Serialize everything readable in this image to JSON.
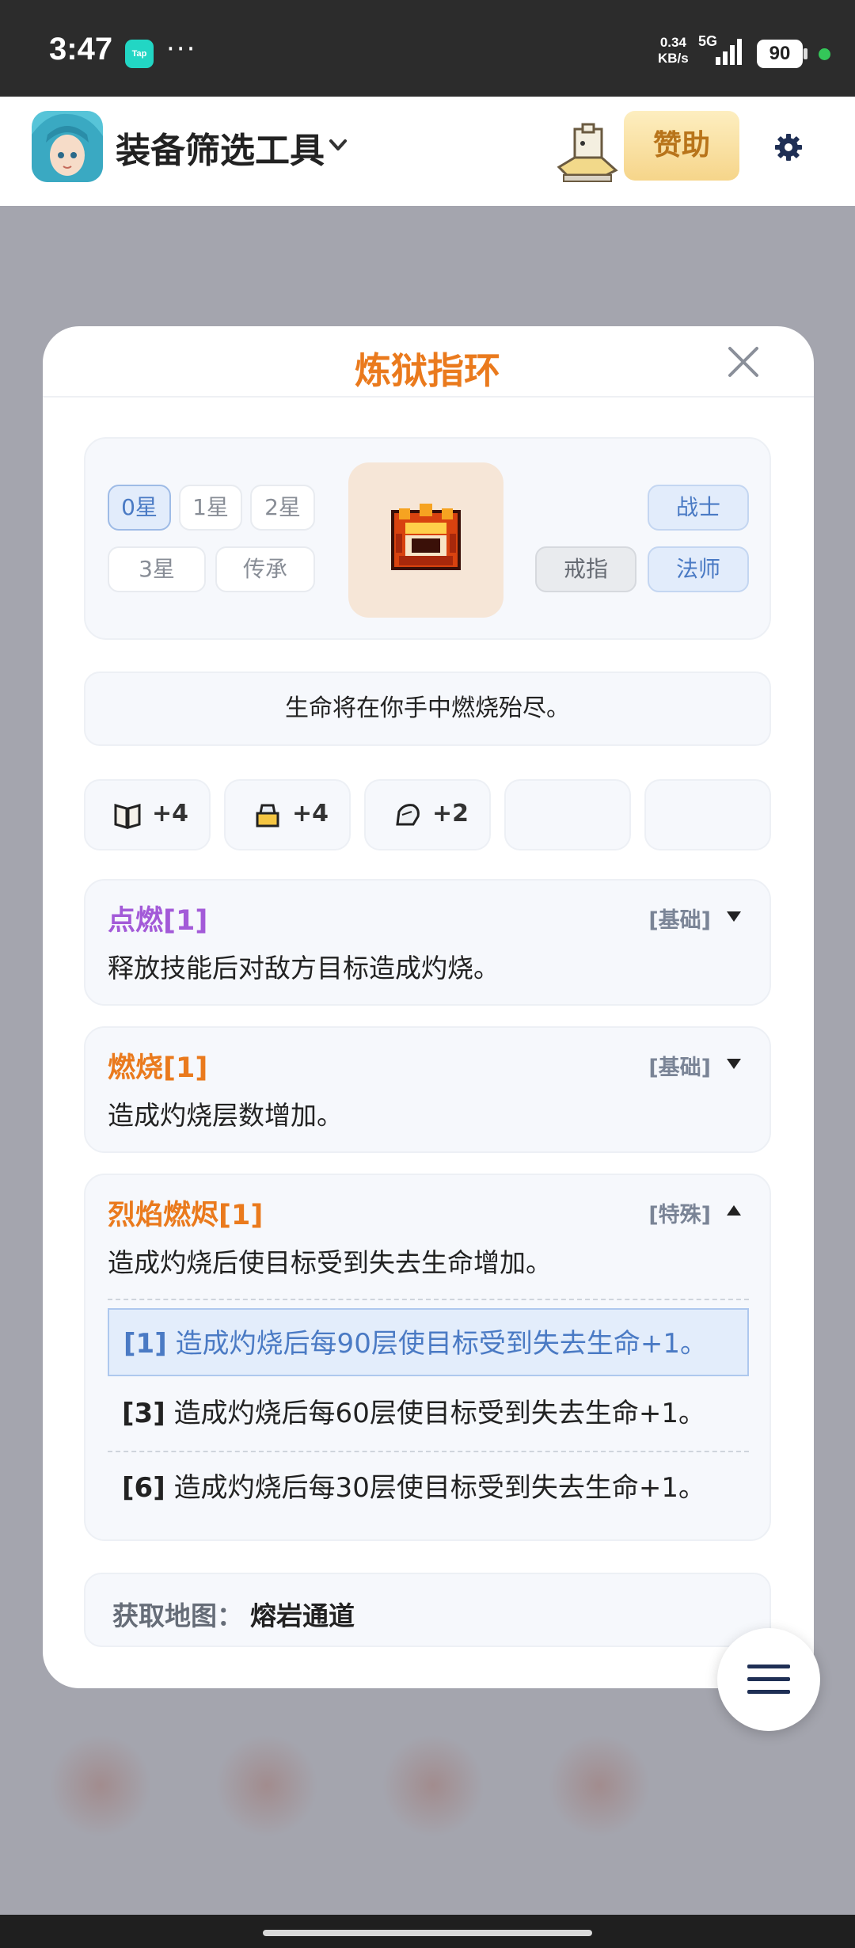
{
  "status_bar": {
    "time": "3:47",
    "app_badge": "Tap",
    "more": "···",
    "net_speed_value": "0.34",
    "net_speed_unit": "KB/s",
    "network": "5G",
    "battery": "90"
  },
  "app_bar": {
    "title": "装备筛选工具",
    "sponsor_label": "赞助"
  },
  "modal": {
    "title": "炼狱指环",
    "star_options": [
      "0星",
      "1星",
      "2星",
      "3星",
      "传承"
    ],
    "selected_star": "0星",
    "type_tag": "戒指",
    "class_tags": [
      "战士",
      "法师"
    ],
    "description": "生命将在你手中燃烧殆尽。",
    "stats": [
      {
        "icon": "book-icon",
        "value": "+4"
      },
      {
        "icon": "armor-icon",
        "value": "+4"
      },
      {
        "icon": "glove-icon",
        "value": "+2"
      },
      {
        "icon": "",
        "value": ""
      },
      {
        "icon": "",
        "value": ""
      }
    ],
    "skills": [
      {
        "name": "点燃[1]",
        "color": "#a35ad8",
        "tag": "[基础]",
        "expanded": false,
        "desc": "释放技能后对敌方目标造成灼烧。"
      },
      {
        "name": "燃烧[1]",
        "color": "#ea7a1d",
        "tag": "[基础]",
        "expanded": false,
        "desc": "造成灼烧层数增加。"
      },
      {
        "name": "烈焰燃烬[1]",
        "color": "#ea7a1d",
        "tag": "[特殊]",
        "expanded": true,
        "desc": "造成灼烧后使目标受到失去生命增加。",
        "levels": [
          {
            "level": "[1]",
            "text": "造成灼烧后每90层使目标受到失去生命+1。",
            "highlight": true
          },
          {
            "level": "[3]",
            "text": "造成灼烧后每60层使目标受到失去生命+1。",
            "highlight": false
          },
          {
            "level": "[6]",
            "text": "造成灼烧后每30层使目标受到失去生命+1。",
            "highlight": false
          }
        ]
      }
    ],
    "map_label": "获取地图：",
    "map_value": "熔岩通道"
  },
  "colors": {
    "accent_orange": "#ea7a1d",
    "accent_blue": "#4a7ac4",
    "purple": "#a35ad8"
  }
}
